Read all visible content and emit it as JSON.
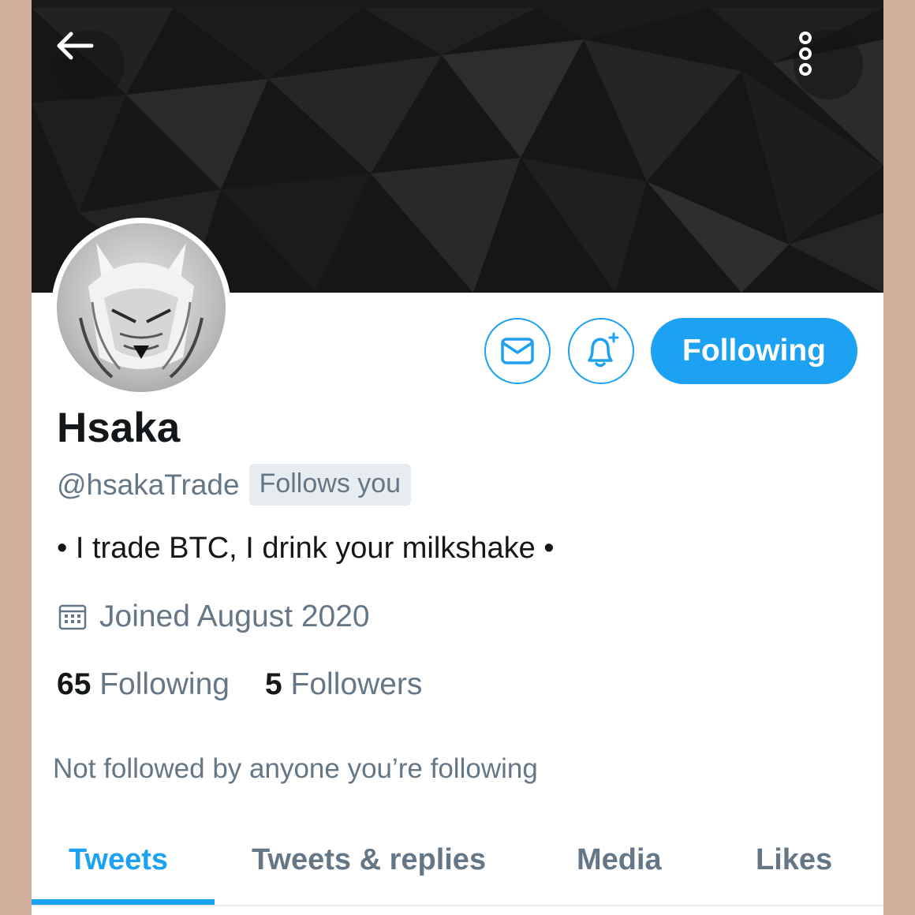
{
  "header": {
    "back_icon": "arrow-left-icon",
    "more_icon": "more-vertical-icon"
  },
  "actions": {
    "message_icon": "envelope-icon",
    "notify_icon": "bell-plus-icon",
    "follow_label": "Following"
  },
  "profile": {
    "name": "Hsaka",
    "handle": "@hsakaTrade",
    "follows_you": "Follows you",
    "bio": "• I trade BTC, I drink your milkshake •",
    "joined": "Joined August 2020",
    "following_count": "65",
    "following_label": "Following",
    "followers_count": "5",
    "followers_label": "Followers",
    "mutuals_text": "Not followed by anyone you’re following"
  },
  "tabs": [
    {
      "label": "Tweets",
      "active": true
    },
    {
      "label": "Tweets & replies",
      "active": false
    },
    {
      "label": "Media",
      "active": false
    },
    {
      "label": "Likes",
      "active": false
    }
  ],
  "colors": {
    "accent": "#1da1f2",
    "secondary_text": "#657786",
    "primary_text": "#14171a",
    "outer_background": "#d2ae9d"
  }
}
